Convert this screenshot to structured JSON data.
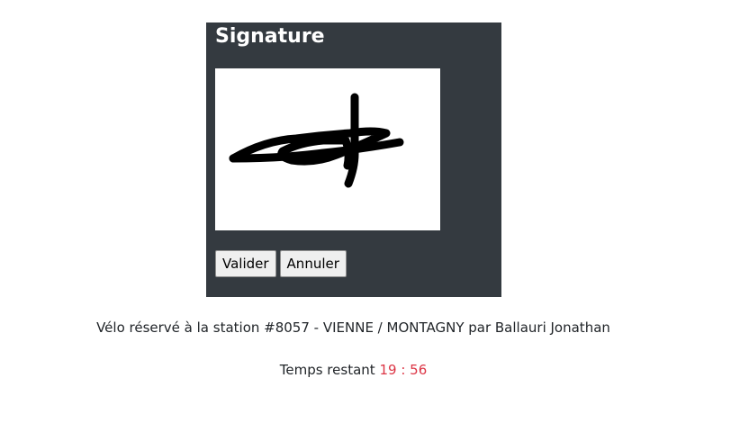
{
  "signature_panel": {
    "title": "Signature",
    "buttons": {
      "validate_label": "Valider",
      "cancel_label": "Annuler"
    }
  },
  "reservation": {
    "text": "Vélo réservé à la station #8057 - VIENNE / MONTAGNY par Ballauri Jonathan"
  },
  "timer": {
    "label": "Temps restant",
    "minutes": "19",
    "separator": ":",
    "seconds": "56",
    "color": "#dc3545"
  },
  "colors": {
    "panel_background": "#343a40",
    "canvas_background": "#ffffff",
    "ink": "#000000"
  }
}
